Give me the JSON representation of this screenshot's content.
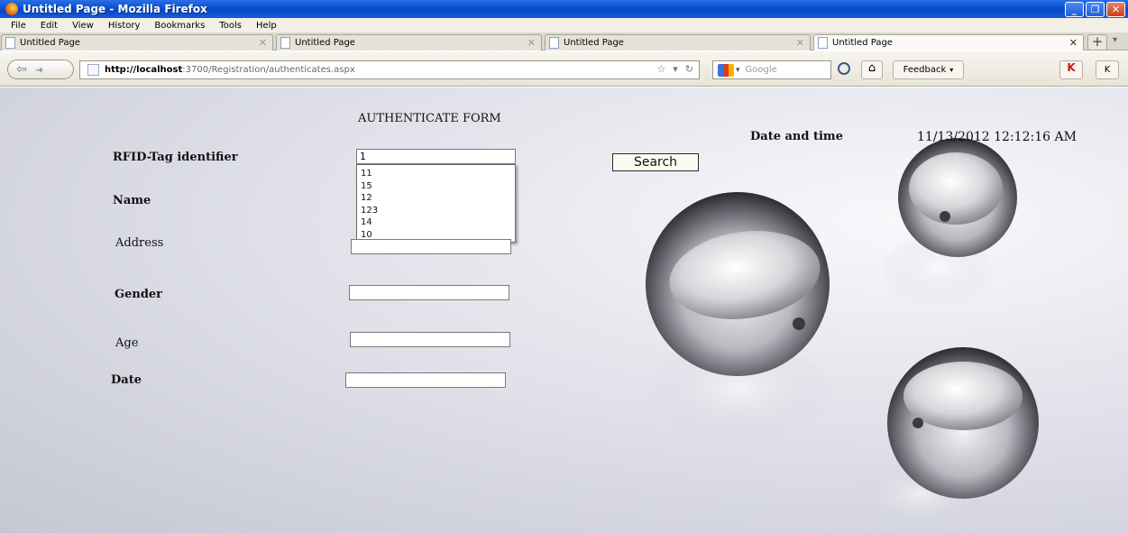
{
  "window": {
    "title": "Untitled Page - Mozilla Firefox"
  },
  "menu": [
    "File",
    "Edit",
    "View",
    "History",
    "Bookmarks",
    "Tools",
    "Help"
  ],
  "tabs": [
    {
      "label": "Untitled Page",
      "active": false
    },
    {
      "label": "Untitled Page",
      "active": false
    },
    {
      "label": "Untitled Page",
      "active": false
    },
    {
      "label": "Untitled Page",
      "active": true
    }
  ],
  "nav": {
    "url_host": "http://localhost",
    "url_path": ":3700/Registration/authenticates.aspx",
    "search_placeholder": "Google",
    "feedback_label": "Feedback",
    "flag_label": "K",
    "ext_label": "K"
  },
  "form": {
    "title": "AUTHENTICATE FORM",
    "rfid_label": "RFID-Tag identifier",
    "rfid_value": "1",
    "suggestions": [
      "11",
      "15",
      "12",
      "123",
      "14",
      "10"
    ],
    "name_label": "Name",
    "address_label": "Address",
    "gender_label": "Gender",
    "age_label": "Age",
    "date_label": "Date",
    "search_label": "Search",
    "datetime_label": "Date and time",
    "datetime_value": "11/13/2012 12:12:16 AM"
  }
}
